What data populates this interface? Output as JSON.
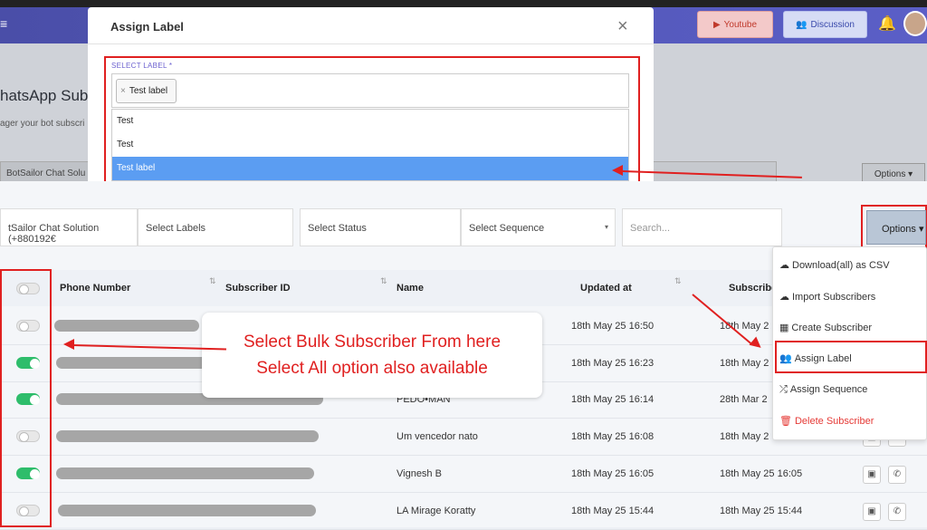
{
  "topbar": {
    "youtube_label": "Youtube",
    "discussion_label": "Discussion",
    "hamburger": "≡",
    "bell_icon": "bell-icon"
  },
  "background": {
    "page_title": "hatsApp Sub",
    "page_subtitle": "ager your bot subscri",
    "account_button": "BotSailor Chat Solu",
    "options_label": "Options ▾"
  },
  "modal": {
    "title": "Assign Label",
    "close": "×",
    "select_label": "SELECT LABEL *",
    "chip_remove": "×",
    "chip_value": "Test label",
    "options": [
      "Test",
      "Test",
      "Test label"
    ],
    "selected_index": 2
  },
  "filters": {
    "account": "tSailor Chat Solution (+880192€",
    "labels_placeholder": "Select Labels",
    "status_placeholder": "Select Status",
    "sequence_placeholder": "Select Sequence",
    "sequence_caret": "▾",
    "search_placeholder": "Search...",
    "options_label": "Options ▾"
  },
  "table": {
    "headers": [
      "Phone Number",
      "Subscriber ID",
      "Name",
      "Updated at",
      "Subscribe"
    ],
    "sort_icon": "⇅",
    "rows": [
      {
        "checked": false,
        "name": "",
        "updated": "18th May 25 16:50",
        "subscribed": "18th May 2"
      },
      {
        "checked": true,
        "name": "",
        "updated": "18th May 25 16:23",
        "subscribed": "18th May 2"
      },
      {
        "checked": true,
        "name": "PEDO•MAN",
        "updated": "18th May 25 16:14",
        "subscribed": "28th Mar 2"
      },
      {
        "checked": false,
        "name": "Um vencedor nato",
        "updated": "18th May 25 16:08",
        "subscribed": "18th May 2"
      },
      {
        "checked": true,
        "name": "Vignesh B",
        "updated": "18th May 25 16:05",
        "subscribed": "18th May 25 16:05"
      },
      {
        "checked": false,
        "name": "LA Mirage Koratty",
        "updated": "18th May 25 15:44",
        "subscribed": "18th May 25 15:44"
      }
    ]
  },
  "options_menu": {
    "items": [
      {
        "icon": "☁",
        "icon_name": "cloud-download-icon",
        "label": "Download(all) as CSV"
      },
      {
        "icon": "☁",
        "icon_name": "cloud-upload-icon",
        "label": "Import Subscribers"
      },
      {
        "icon": "▦",
        "icon_name": "create-icon",
        "label": "Create Subscriber"
      },
      {
        "icon": "👥",
        "icon_name": "users-icon",
        "label": "Assign Label"
      },
      {
        "icon": "⤮",
        "icon_name": "shuffle-icon",
        "label": "Assign Sequence"
      },
      {
        "icon": "🗑",
        "icon_name": "trash-icon",
        "label": "Delete Subscriber"
      }
    ]
  },
  "annotation": {
    "line1": "Select Bulk Subscriber From here",
    "line2": "Select All option also available"
  },
  "colors": {
    "accent": "#5b5fc7",
    "annotation_red": "#e02020",
    "toggle_on": "#2ebd6b",
    "selected_option": "#5b9df2"
  }
}
